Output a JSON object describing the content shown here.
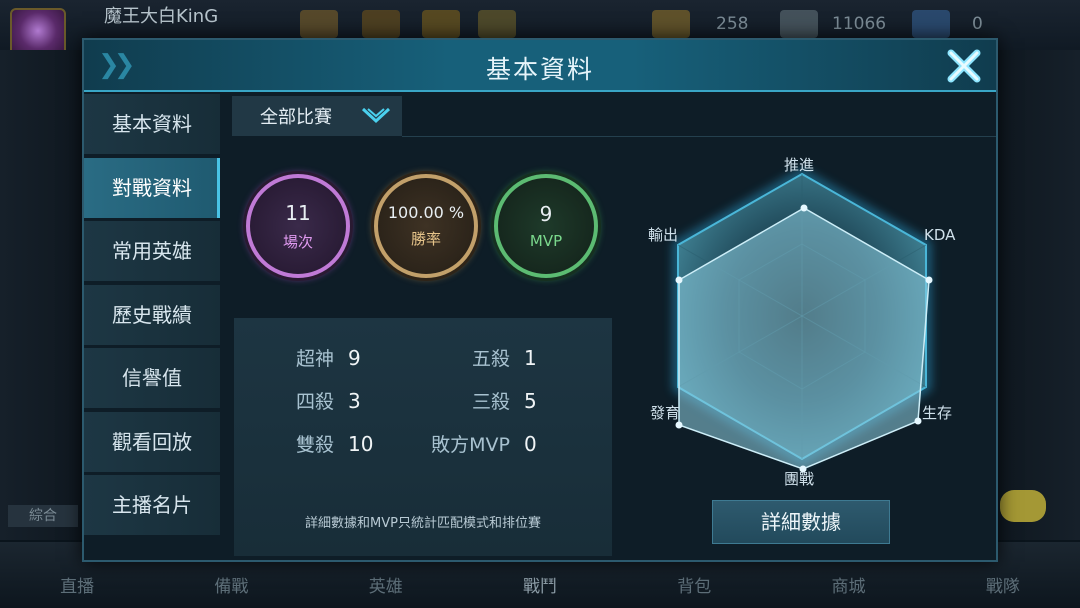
{
  "background": {
    "player_name": "魔王大白KinG",
    "currency": [
      "258",
      "11066",
      "0"
    ],
    "left_tab": "綜合",
    "bottom_nav": [
      "直播",
      "備戰",
      "英雄",
      "戰鬥",
      "背包",
      "商城",
      "戰隊"
    ]
  },
  "dialog": {
    "title": "基本資料",
    "menu": [
      "基本資料",
      "對戰資料",
      "常用英雄",
      "歷史戰績",
      "信譽值",
      "觀看回放",
      "主播名片"
    ],
    "active_menu": "對戰資料",
    "filter": "全部比賽",
    "summary": {
      "games_value": "11",
      "games_label": "場次",
      "winrate_value": "100.00 %",
      "winrate_label": "勝率",
      "mvp_value": "9",
      "mvp_label": "MVP"
    },
    "stats": {
      "legendary_label": "超神",
      "legendary_value": "9",
      "penta_label": "五殺",
      "penta_value": "1",
      "quadra_label": "四殺",
      "quadra_value": "3",
      "triple_label": "三殺",
      "triple_value": "5",
      "double_label": "雙殺",
      "double_value": "10",
      "losing_mvp_label": "敗方MVP",
      "losing_mvp_value": "0",
      "note": "詳細數據和MVP只統計匹配模式和排位賽"
    },
    "radar": {
      "axes": [
        "推進",
        "KDA",
        "生存",
        "團戰",
        "發育",
        "輸出"
      ]
    },
    "detail_button": "詳細數據"
  },
  "colors": {
    "accent": "#49c3e6",
    "games_ring": "#c07ad6",
    "winrate_ring": "#c2a06a",
    "mvp_ring": "#5cbb72"
  }
}
